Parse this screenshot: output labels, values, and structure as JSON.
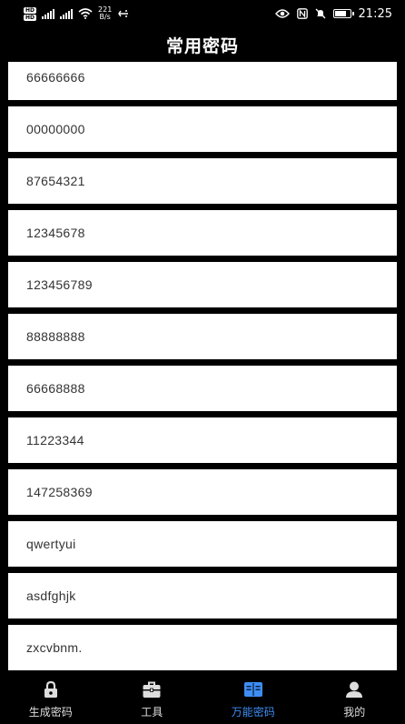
{
  "status_bar": {
    "hd_badges": [
      "HD",
      "HD"
    ],
    "net_speed_value": "221",
    "net_speed_unit": "B/s",
    "time": "21:25"
  },
  "header": {
    "title": "常用密码"
  },
  "passwords": [
    "66666666",
    "00000000",
    "87654321",
    "12345678",
    "123456789",
    "88888888",
    "66668888",
    "11223344",
    "147258369",
    "qwertyui",
    "asdfghjk",
    "zxcvbnm."
  ],
  "bottom_nav": {
    "items": [
      {
        "label": "生成密码",
        "icon": "lock-icon",
        "active": false
      },
      {
        "label": "工具",
        "icon": "toolbox-icon",
        "active": false
      },
      {
        "label": "万能密码",
        "icon": "book-icon",
        "active": true
      },
      {
        "label": "我的",
        "icon": "user-icon",
        "active": false
      }
    ]
  },
  "colors": {
    "background": "#000000",
    "item_background": "#ffffff",
    "item_text": "#333333",
    "accent": "#3e8df5"
  }
}
